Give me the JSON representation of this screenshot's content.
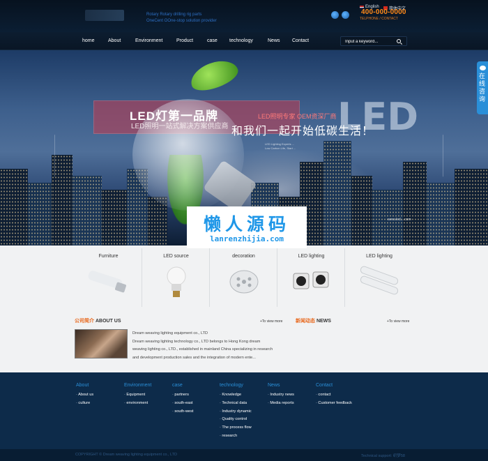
{
  "header": {
    "slogan_line1": "Rotary Rotary drilling rig parts",
    "slogan_line2": "OneCent OOne-stop solution provider",
    "lang_english": "English",
    "lang_chinese": "简体中文",
    "phone": "400-000-0000",
    "hotline_label": "TELPHONE / CONTACT"
  },
  "nav": {
    "items": [
      "home",
      "About",
      "Environment",
      "Product",
      "case",
      "technology",
      "News",
      "Contact"
    ],
    "search_placeholder": "Input a keyword..."
  },
  "banner": {
    "title": "LED灯第一品牌",
    "subtitle": "LED照明一站式解决方案供应商",
    "tag": "LED照明专家  OEM资深厂商",
    "big_text": "LED",
    "slogan": "和我们一起开始低碳生活！",
    "english_lines": [
      "LED Lighting Experts ...",
      "Low Carbon Life, Start ..."
    ],
    "url": "www.led....com"
  },
  "watermark": {
    "cn": "懒人源码",
    "en": "lanrenzhijia.com"
  },
  "side_tab": {
    "label": "在线咨询"
  },
  "products": [
    {
      "label": "Furniture",
      "icon": "tube-light-icon"
    },
    {
      "label": "LED source",
      "icon": "bulb-icon"
    },
    {
      "label": "decoration",
      "icon": "downlight-icon"
    },
    {
      "label": "LED lighting",
      "icon": "spotlight-icon"
    },
    {
      "label": "LED lighting",
      "icon": "tube-light-icon"
    }
  ],
  "about": {
    "title_cn": "公司简介",
    "title_en": "ABOUT US",
    "more": "+To view more",
    "lines": [
      "Dream weaving lighting equipment co., LTD",
      "Dream weaving lighting technology co., LTD belongs to Hong Kong dream",
      "weaving lighting co., LTD., established in mainland China specializing in research",
      "and development production sales and the integration of modern ente..."
    ]
  },
  "news": {
    "title_cn": "新闻动态",
    "title_en": "NEWS",
    "more": "+To view more"
  },
  "footer": {
    "columns": [
      {
        "head": "About",
        "links": [
          "About us",
          "culture"
        ]
      },
      {
        "head": "Environment",
        "links": [
          "Equipment",
          "environment"
        ]
      },
      {
        "head": "case",
        "links": [
          "partners",
          "south-east",
          "south-west"
        ]
      },
      {
        "head": "technology",
        "links": [
          "Knowledge",
          "Technical data",
          "Industry dynamic",
          "Quality control",
          "The process flow",
          "research"
        ]
      },
      {
        "head": "News",
        "links": [
          "Industry news",
          "Media reports"
        ]
      },
      {
        "head": "Contact",
        "links": [
          "contact",
          "Customer feedback"
        ]
      }
    ],
    "copyright": "COPYRIGHT © Dream weaving lighting equipment co., LTD",
    "support": "Technical support: 织梦58"
  },
  "colors": {
    "accent_blue": "#2a8fd8",
    "phone_orange": "#ff8a1a",
    "news_orange": "#e8671b",
    "footer_bg": "#0d2b4a"
  }
}
